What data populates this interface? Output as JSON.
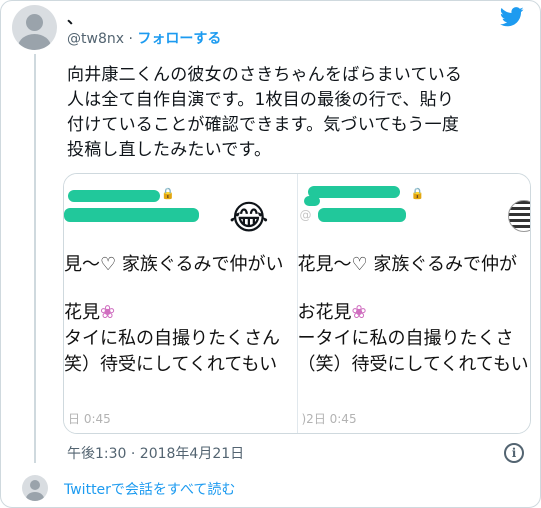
{
  "colors": {
    "accent": "#1d9bf0",
    "scribble": "#21c89b",
    "muted": "#536471"
  },
  "author": {
    "name": "、",
    "handle": "@tw8nx",
    "separator": "·",
    "follow_label": "フォローする"
  },
  "tweet": {
    "lines": [
      "向井康二くんの彼女のさきちゃんをばらまいている",
      "人は全て自作自演です。1枚目の最後の行で、貼り",
      "付けていることが確認できます。気づいてもう一度",
      "投稿し直したみたいです。"
    ],
    "timestamp": "午後1:30 · 2018年4月21日"
  },
  "media": {
    "left": {
      "emoji": "😂",
      "line1": "見～♡ 家族ぐるみで仲がい",
      "line2_text": "花見",
      "line2_flower": "❀",
      "line3": "タイに私の自撮りたくさん",
      "line4": "笑）待受にしてくれてもい",
      "time": "日 0:45"
    },
    "right": {
      "handle_fragment": "@",
      "line1": "花見～♡ 家族ぐるみで仲が",
      "line2_text": "お花見",
      "line2_flower": "❀",
      "line3": "ータイに私の自撮りたくさ",
      "line4": "（笑）待受にしてくれてもい",
      "time": ")2日 0:45"
    }
  },
  "icons": {
    "bird": "twitter-bird-icon",
    "lock": "🔒",
    "info": "i"
  },
  "reply": {
    "link_label": "Twitterで会話をすべて読む"
  }
}
